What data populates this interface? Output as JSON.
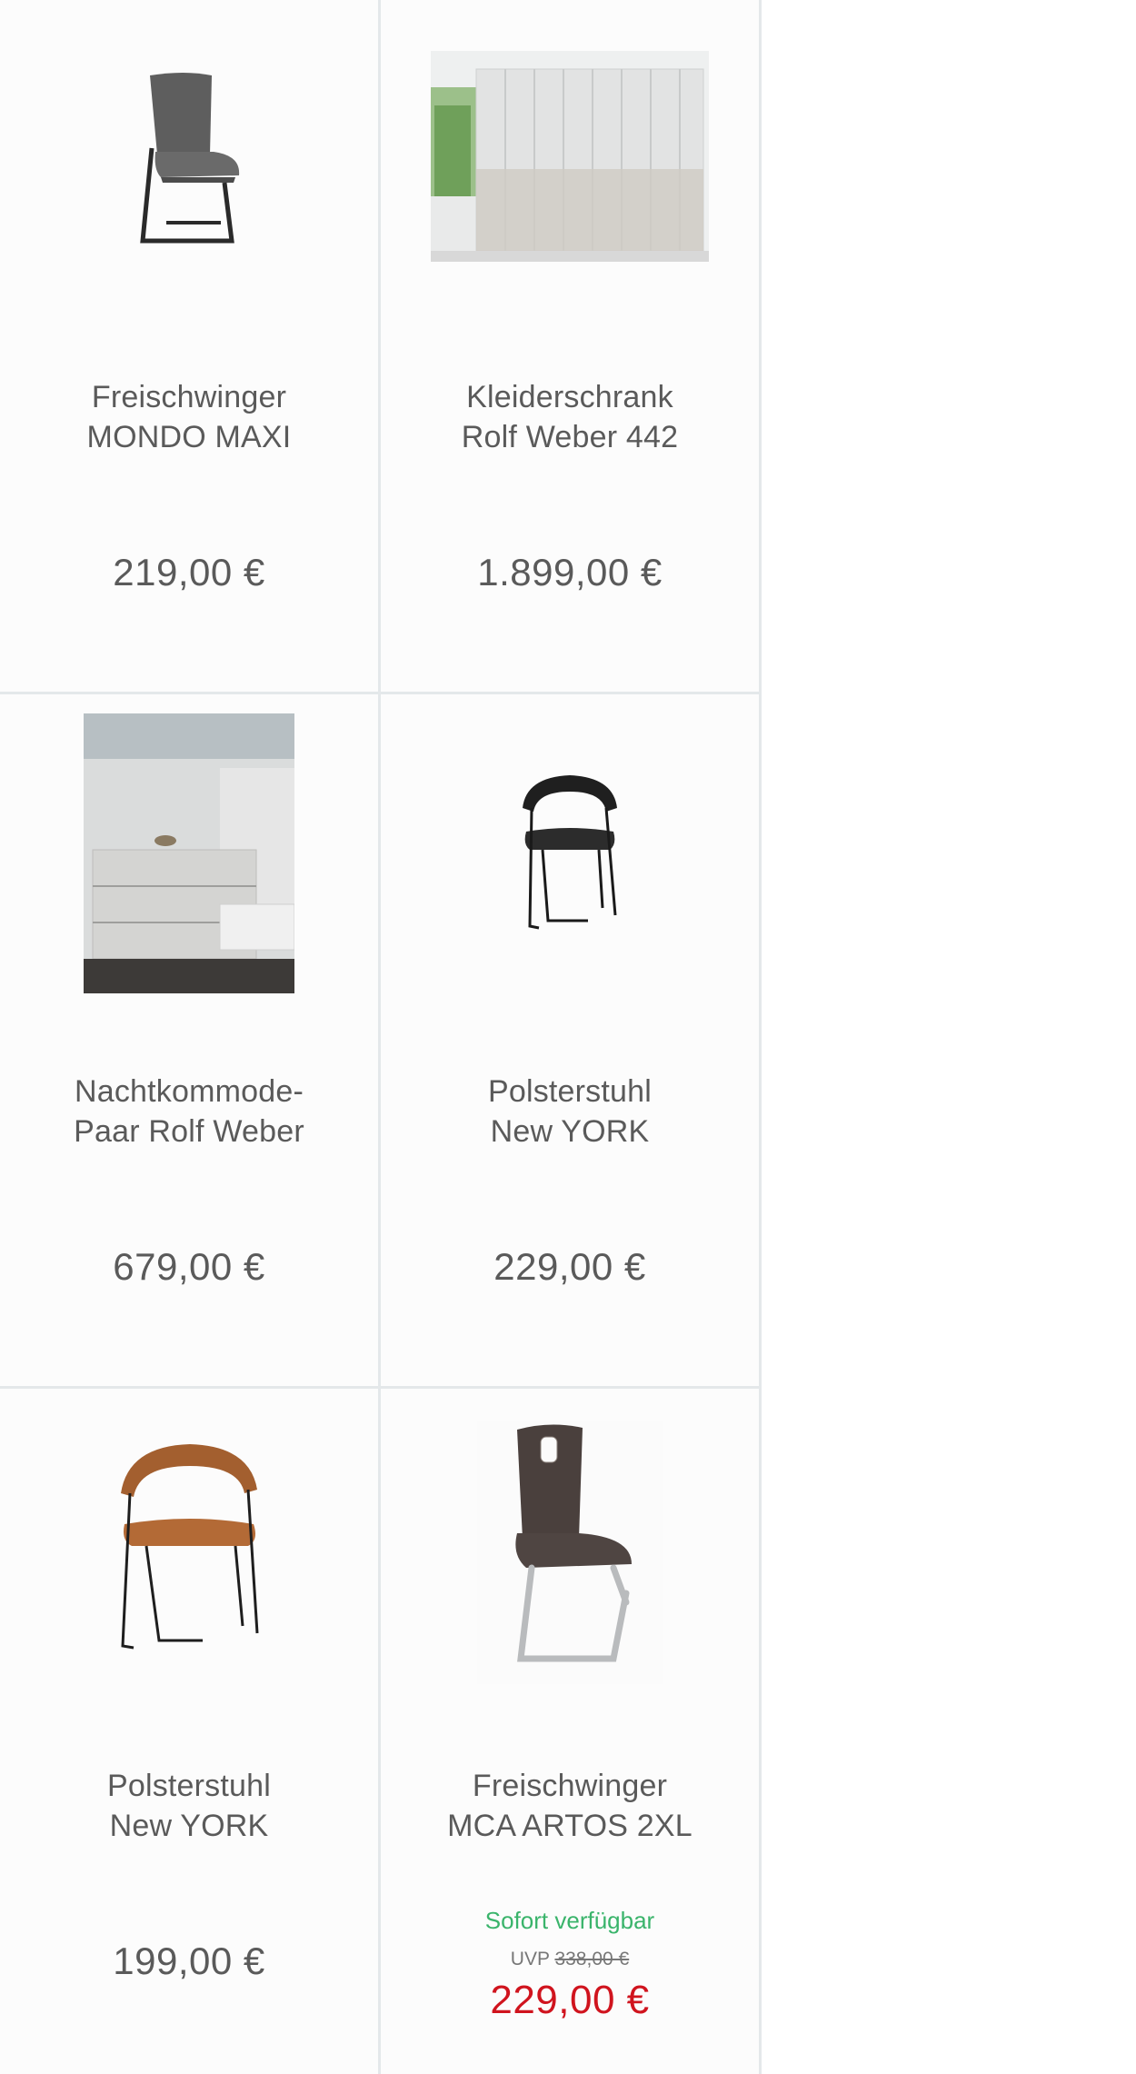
{
  "products": [
    {
      "title_line1": "Freischwinger",
      "title_line2": "MONDO MAXI",
      "price": "219,00 €",
      "image": "cantilever-chair-grey"
    },
    {
      "title_line1": "Kleiderschrank",
      "title_line2": "Rolf Weber 442",
      "price": "1.899,00 €",
      "image": "wardrobe-white"
    },
    {
      "title_line1": "Nachtkommode-",
      "title_line2": "Paar Rolf Weber",
      "price": "679,00 €",
      "image": "nightstand-bedroom"
    },
    {
      "title_line1": "Polsterstuhl",
      "title_line2": "New YORK",
      "price": "229,00 €",
      "image": "chair-black"
    },
    {
      "title_line1": "Polsterstuhl",
      "title_line2": "New YORK",
      "price": "199,00 €",
      "image": "chair-cognac"
    },
    {
      "title_line1": "Freischwinger",
      "title_line2": "MCA ARTOS 2XL",
      "availability": "Sofort verfügbar",
      "uvp_label": "UVP",
      "uvp_price": "338,00 €",
      "sale_price": "229,00 €",
      "image": "cantilever-chair-brown"
    }
  ],
  "colors": {
    "availability": "#3ab46b",
    "sale": "#d0141e",
    "text": "#5a5a5a",
    "border": "#e4e8ea"
  }
}
